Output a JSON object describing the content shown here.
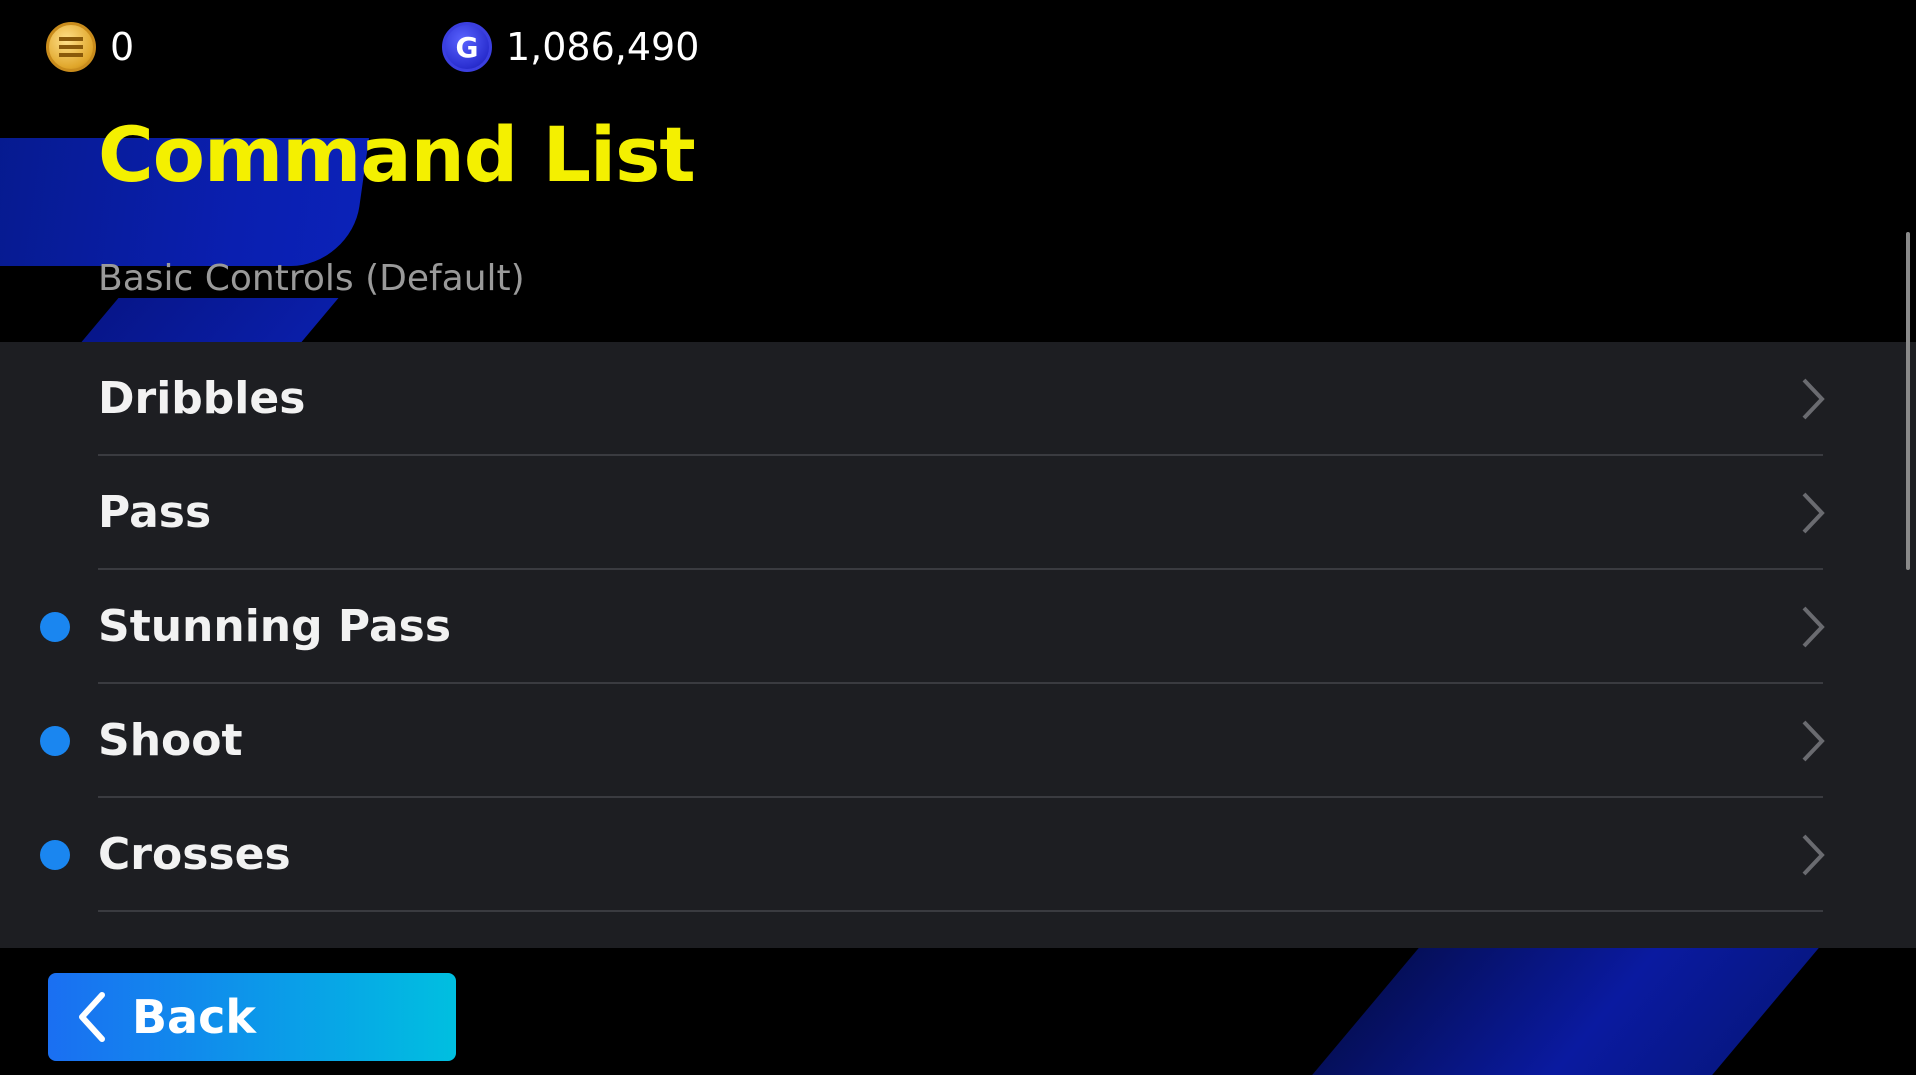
{
  "currency": {
    "coins": "0",
    "gp": "1,086,490",
    "coin_icon": "coin-icon",
    "gp_icon": "gp-icon",
    "gp_symbol": "G"
  },
  "header": {
    "title": "Command List",
    "subtitle": "Basic Controls (Default)"
  },
  "list": {
    "items": [
      {
        "label": "Dribbles",
        "new_indicator": false
      },
      {
        "label": "Pass",
        "new_indicator": false
      },
      {
        "label": "Stunning Pass",
        "new_indicator": true
      },
      {
        "label": "Shoot",
        "new_indicator": true
      },
      {
        "label": "Crosses",
        "new_indicator": true
      }
    ]
  },
  "footer": {
    "back_label": "Back"
  },
  "colors": {
    "title": "#f4f000",
    "indicator": "#1a86f0",
    "panel": "#1d1e22",
    "button_start": "#1a6ff2",
    "button_end": "#00bfe0"
  }
}
